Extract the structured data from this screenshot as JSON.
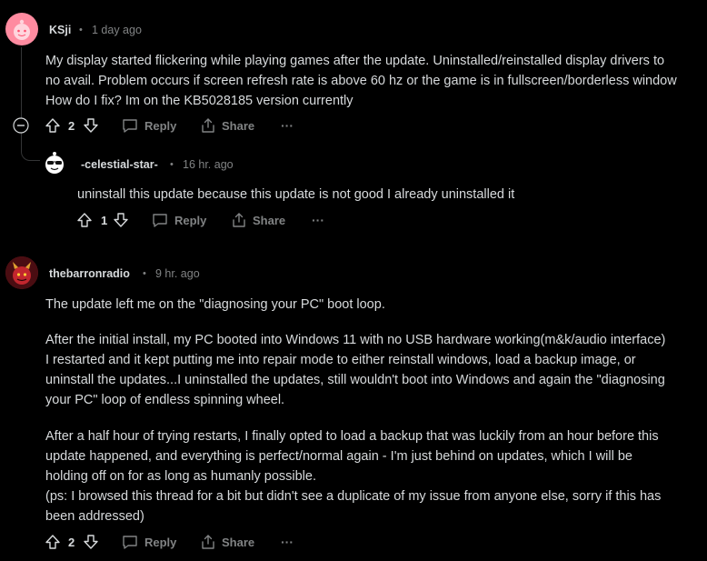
{
  "comments": [
    {
      "author": "KSji",
      "sep": "•",
      "time": "1 day ago",
      "lines": [
        "My display started flickering while playing games after the update. Uninstalled/reinstalled display drivers to",
        "no avail. Problem occurs if screen refresh rate is above 60 hz or the game is in fullscreen/borderless window",
        "How do I fix? Im on the KB5028185 version currently"
      ],
      "score": "2",
      "reply": "Reply",
      "share": "Share",
      "more": "···"
    },
    {
      "author": "-celestial-star-",
      "sep": "•",
      "time": "16 hr. ago",
      "lines": [
        "uninstall this update because this update is not good I already uninstalled it"
      ],
      "score": "1",
      "reply": "Reply",
      "share": "Share",
      "more": "···"
    },
    {
      "author": "thebarronradio",
      "sep": "•",
      "time": "9 hr. ago",
      "paragraphs": [
        [
          "The update left me on the \"diagnosing your PC\" boot loop."
        ],
        [
          "After the initial install, my PC booted into Windows 11 with no USB hardware working(m&k/audio interface)",
          "I restarted and it kept putting me into repair mode to either reinstall windows, load a backup image, or",
          "uninstall the updates...I uninstalled the updates, still wouldn't boot into Windows and again the \"diagnosing",
          "your PC\" loop of endless spinning wheel."
        ],
        [
          "After a half hour of trying restarts, I finally opted to load a backup that was luckily from an hour before this",
          "update happened, and everything is perfect/normal again - I'm just behind on updates, which I will be",
          "holding off on for as long as humanly possible.",
          "(ps: I browsed this thread for a bit but didn't see a duplicate of my issue from anyone else, sorry if this has",
          "been addressed)"
        ]
      ],
      "score": "2",
      "reply": "Reply",
      "share": "Share",
      "more": "···"
    }
  ],
  "colors": {
    "background": "#000000",
    "text": "#d7dadc",
    "muted": "#818384",
    "thread_line": "#343536",
    "avatar1_bg": "#ff8ba0",
    "avatar3_bg": "#7a1a1a"
  },
  "icons": [
    "upvote-icon",
    "downvote-icon",
    "comment-icon",
    "share-icon",
    "more-icon",
    "collapse-icon"
  ]
}
